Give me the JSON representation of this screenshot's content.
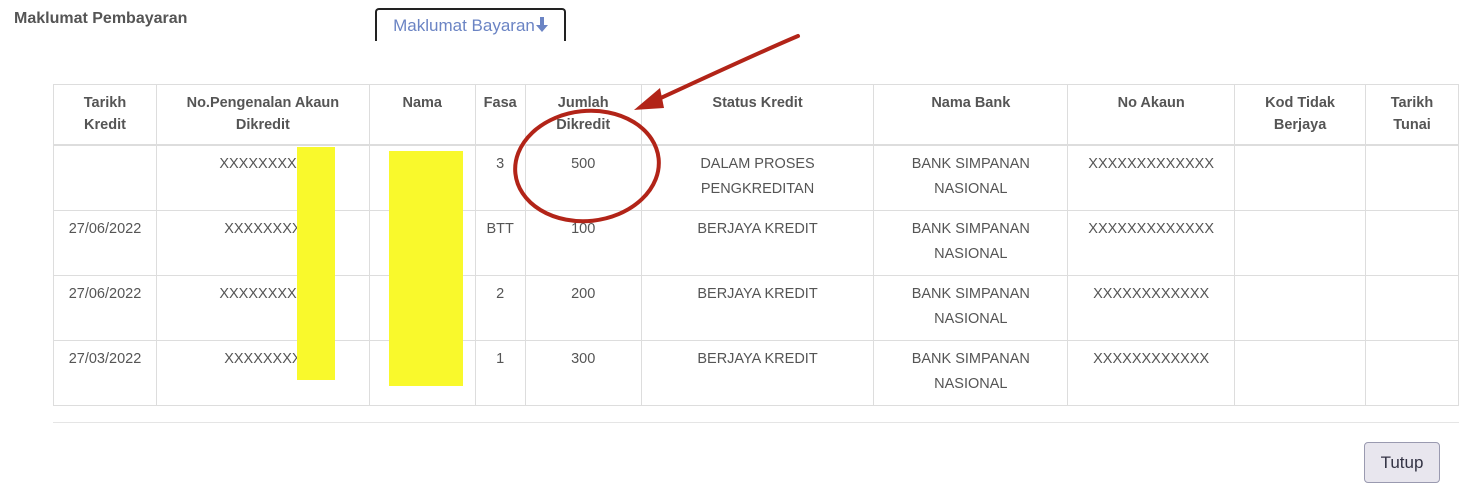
{
  "section": {
    "title": "Maklumat Pembayaran"
  },
  "tab": {
    "label": "Maklumat Bayaran",
    "icon": "arrow-down-icon",
    "color": "#6b84c4"
  },
  "table": {
    "headers": [
      "Tarikh Kredit",
      "No.Pengenalan Akaun Dikredit",
      "Nama",
      "Fasa",
      "Jumlah Dikredit",
      "Status Kredit",
      "Nama Bank",
      "No Akaun",
      "Kod Tidak Berjaya",
      "Tarikh Tunai"
    ],
    "rows": [
      {
        "tarikh_kredit": "",
        "no_pengenalan": "XXXXXXXXX",
        "nama": "",
        "fasa": "3",
        "jumlah": "500",
        "status": "DALAM PROSES PENGKREDITAN",
        "bank": "BANK SIMPANAN NASIONAL",
        "no_akaun": "XXXXXXXXXXXXX",
        "kod": "",
        "tarikh_tunai": ""
      },
      {
        "tarikh_kredit": "27/06/2022",
        "no_pengenalan": "XXXXXXXX",
        "nama": "",
        "fasa": "BTT",
        "jumlah": "100",
        "status": "BERJAYA KREDIT",
        "bank": "BANK SIMPANAN NASIONAL",
        "no_akaun": "XXXXXXXXXXXXX",
        "kod": "",
        "tarikh_tunai": ""
      },
      {
        "tarikh_kredit": "27/06/2022",
        "no_pengenalan": "XXXXXXXXX",
        "nama": "",
        "fasa": "2",
        "jumlah": "200",
        "status": "BERJAYA KREDIT",
        "bank": "BANK SIMPANAN NASIONAL",
        "no_akaun": "XXXXXXXXXXXX",
        "kod": "",
        "tarikh_tunai": ""
      },
      {
        "tarikh_kredit": "27/03/2022",
        "no_pengenalan": "XXXXXXXX",
        "nama": "",
        "fasa": "1",
        "jumlah": "300",
        "status": "BERJAYA KREDIT",
        "bank": "BANK SIMPANAN NASIONAL",
        "no_akaun": "XXXXXXXXXXXX",
        "kod": "",
        "tarikh_tunai": ""
      }
    ]
  },
  "footer": {
    "close_label": "Tutup"
  },
  "colors": {
    "redaction": "#f9f92c",
    "annotation": "#b22418"
  }
}
